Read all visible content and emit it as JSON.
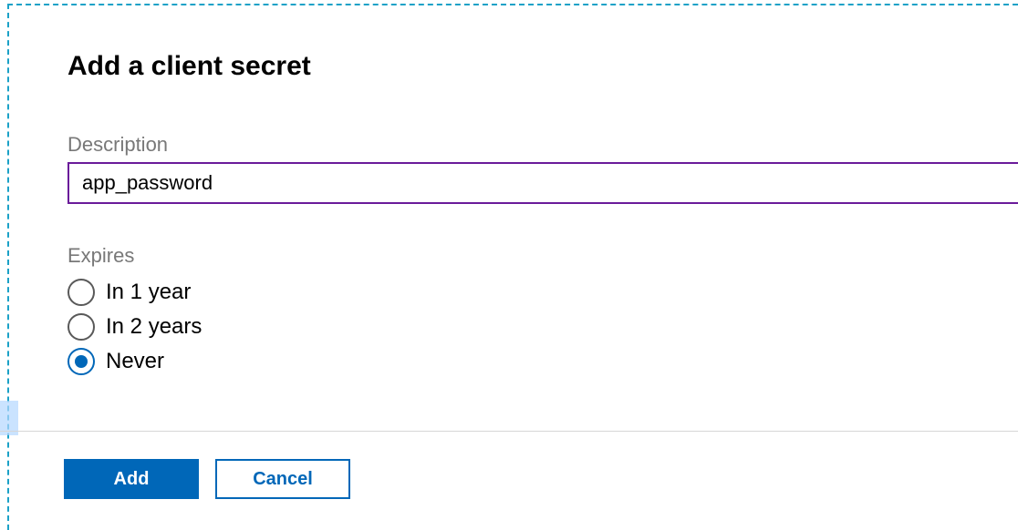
{
  "panel": {
    "title": "Add a client secret",
    "description": {
      "label": "Description",
      "value": "app_password"
    },
    "expires": {
      "label": "Expires",
      "options": [
        {
          "label": "In 1 year",
          "selected": false
        },
        {
          "label": "In 2 years",
          "selected": false
        },
        {
          "label": "Never",
          "selected": true
        }
      ]
    },
    "actions": {
      "primary": "Add",
      "secondary": "Cancel"
    }
  },
  "colors": {
    "accent": "#0067b8",
    "dashedBorder": "#1ba1c7",
    "inputBorder": "#6a1b9a",
    "labelGray": "#787878"
  }
}
